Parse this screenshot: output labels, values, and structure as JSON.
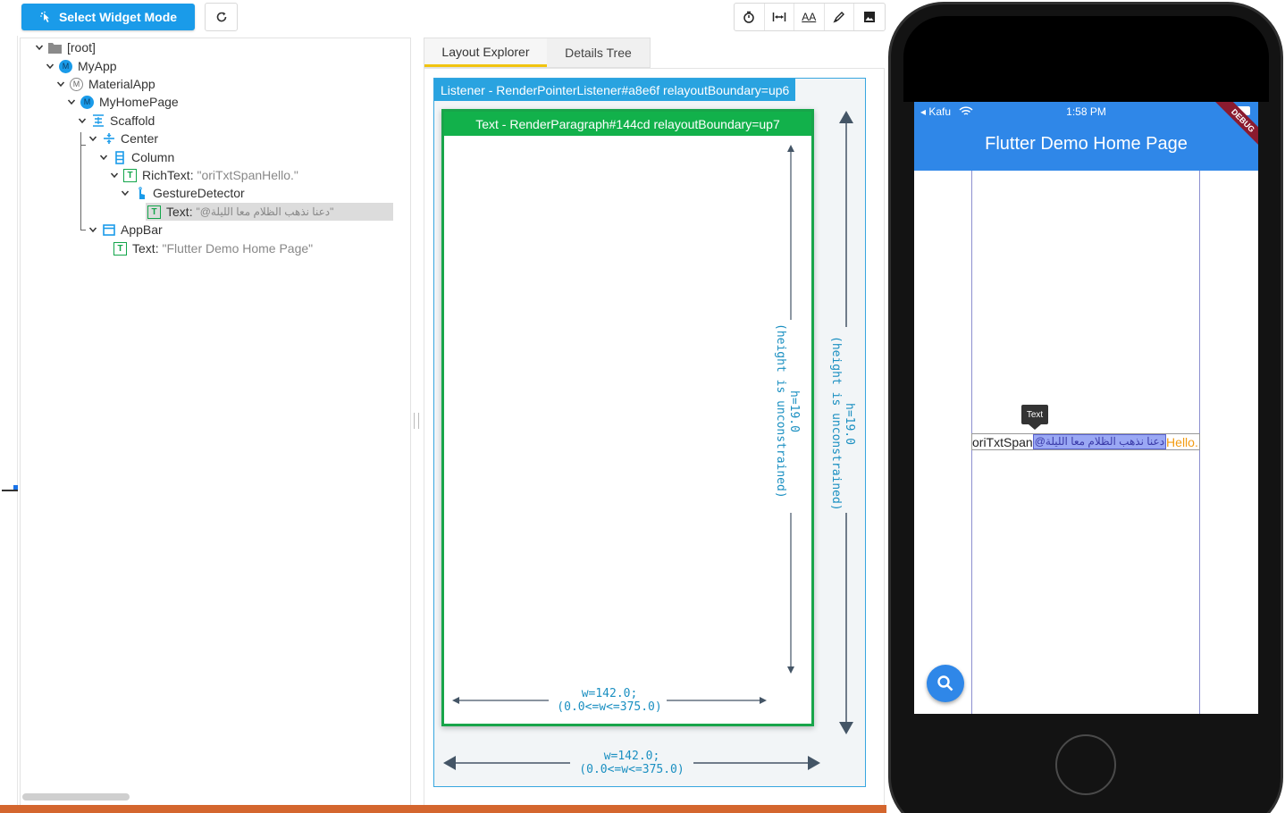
{
  "toolbar": {
    "select_widget_mode": "Select Widget Mode",
    "tools": [
      "timer-icon",
      "width-icon",
      "text-size-icon",
      "paint-icon",
      "image-icon"
    ],
    "text_size_label": "AA"
  },
  "tree": {
    "nodes": [
      {
        "name": "[root]",
        "desc": ""
      },
      {
        "name": "MyApp",
        "desc": ""
      },
      {
        "name": "MaterialApp",
        "desc": ""
      },
      {
        "name": "MyHomePage",
        "desc": ""
      },
      {
        "name": "Scaffold",
        "desc": ""
      },
      {
        "name": "Center",
        "desc": ""
      },
      {
        "name": "Column",
        "desc": ""
      },
      {
        "name": "RichText",
        "desc": "\"oriTxtSpan⁣Hello.\""
      },
      {
        "name": "GestureDetector",
        "desc": ""
      },
      {
        "name": "Text",
        "desc": "\"@دعنا نذهب الظلام معا الليلة\""
      },
      {
        "name": "AppBar",
        "desc": ""
      },
      {
        "name": "Text",
        "desc": "\"Flutter Demo Home Page\""
      }
    ],
    "icon_letters": {
      "myapp": "M",
      "myhomepage": "M",
      "materialapp": "M",
      "text": "T",
      "richtext": "T"
    }
  },
  "tabs": {
    "layout_explorer": "Layout Explorer",
    "details_tree": "Details Tree"
  },
  "layout": {
    "listener_header": "Listener - RenderPointerListener#a8e6f relayoutBoundary=up6",
    "text_header": "Text - RenderParagraph#144cd relayoutBoundary=up7",
    "inner_height_label": "h=19.0\n(height is unconstrained)",
    "outer_height_label": "h=19.0\n(height is unconstrained)",
    "inner_width_label_1": "w=142.0;",
    "inner_width_label_2": "(0.0<=w<=375.0)",
    "outer_width_label_1": "w=142.0;",
    "outer_width_label_2": "(0.0<=w<=375.0)"
  },
  "phone": {
    "carrier": "Kafu",
    "time": "1:58 PM",
    "app_title": "Flutter Demo Home Page",
    "debug_banner": "DEBUG",
    "tooltip": "Text",
    "text_part1": "oriTxtSpan",
    "text_part2": "@دعنا نذهب الظلام معا الليلة",
    "text_part3": "Hello."
  },
  "colors": {
    "accent_blue": "#1a9be9",
    "green_selection": "#12b14b",
    "app_bar": "#2f87e8",
    "orange_text": "#f39c12"
  }
}
